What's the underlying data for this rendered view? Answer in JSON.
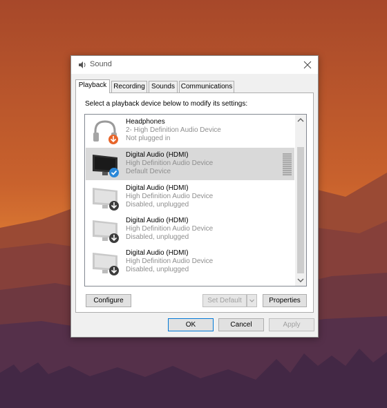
{
  "window": {
    "title": "Sound",
    "icon": "speaker-icon"
  },
  "tabs": [
    {
      "label": "Playback",
      "active": true
    },
    {
      "label": "Recording",
      "active": false
    },
    {
      "label": "Sounds",
      "active": false
    },
    {
      "label": "Communications",
      "active": false
    }
  ],
  "instruction": "Select a playback device below to modify its settings:",
  "devices": [
    {
      "name": "Headphones",
      "description": "2- High Definition Audio Device",
      "status": "Not plugged in",
      "icon": "headphones-icon",
      "badge": "down-arrow-orange"
    },
    {
      "name": "Digital Audio (HDMI)",
      "description": "High Definition Audio Device",
      "status": "Default Device",
      "icon": "monitor-icon",
      "badge": "green-check",
      "selected": true
    },
    {
      "name": "Digital Audio (HDMI)",
      "description": "High Definition Audio Device",
      "status": "Disabled, unplugged",
      "icon": "monitor-icon",
      "badge": "down-arrow-dark"
    },
    {
      "name": "Digital Audio (HDMI)",
      "description": "High Definition Audio Device",
      "status": "Disabled, unplugged",
      "icon": "monitor-icon",
      "badge": "down-arrow-dark"
    },
    {
      "name": "Digital Audio (HDMI)",
      "description": "High Definition Audio Device",
      "status": "Disabled, unplugged",
      "icon": "monitor-icon",
      "badge": "down-arrow-dark"
    }
  ],
  "buttons": {
    "configure": "Configure",
    "set_default": "Set Default",
    "properties": "Properties",
    "ok": "OK",
    "cancel": "Cancel",
    "apply": "Apply"
  },
  "colors": {
    "accent": "#0078d7",
    "selected_row": "#d9d9d9",
    "badge_check": "#2b88d8",
    "badge_orange": "#e8652a"
  }
}
